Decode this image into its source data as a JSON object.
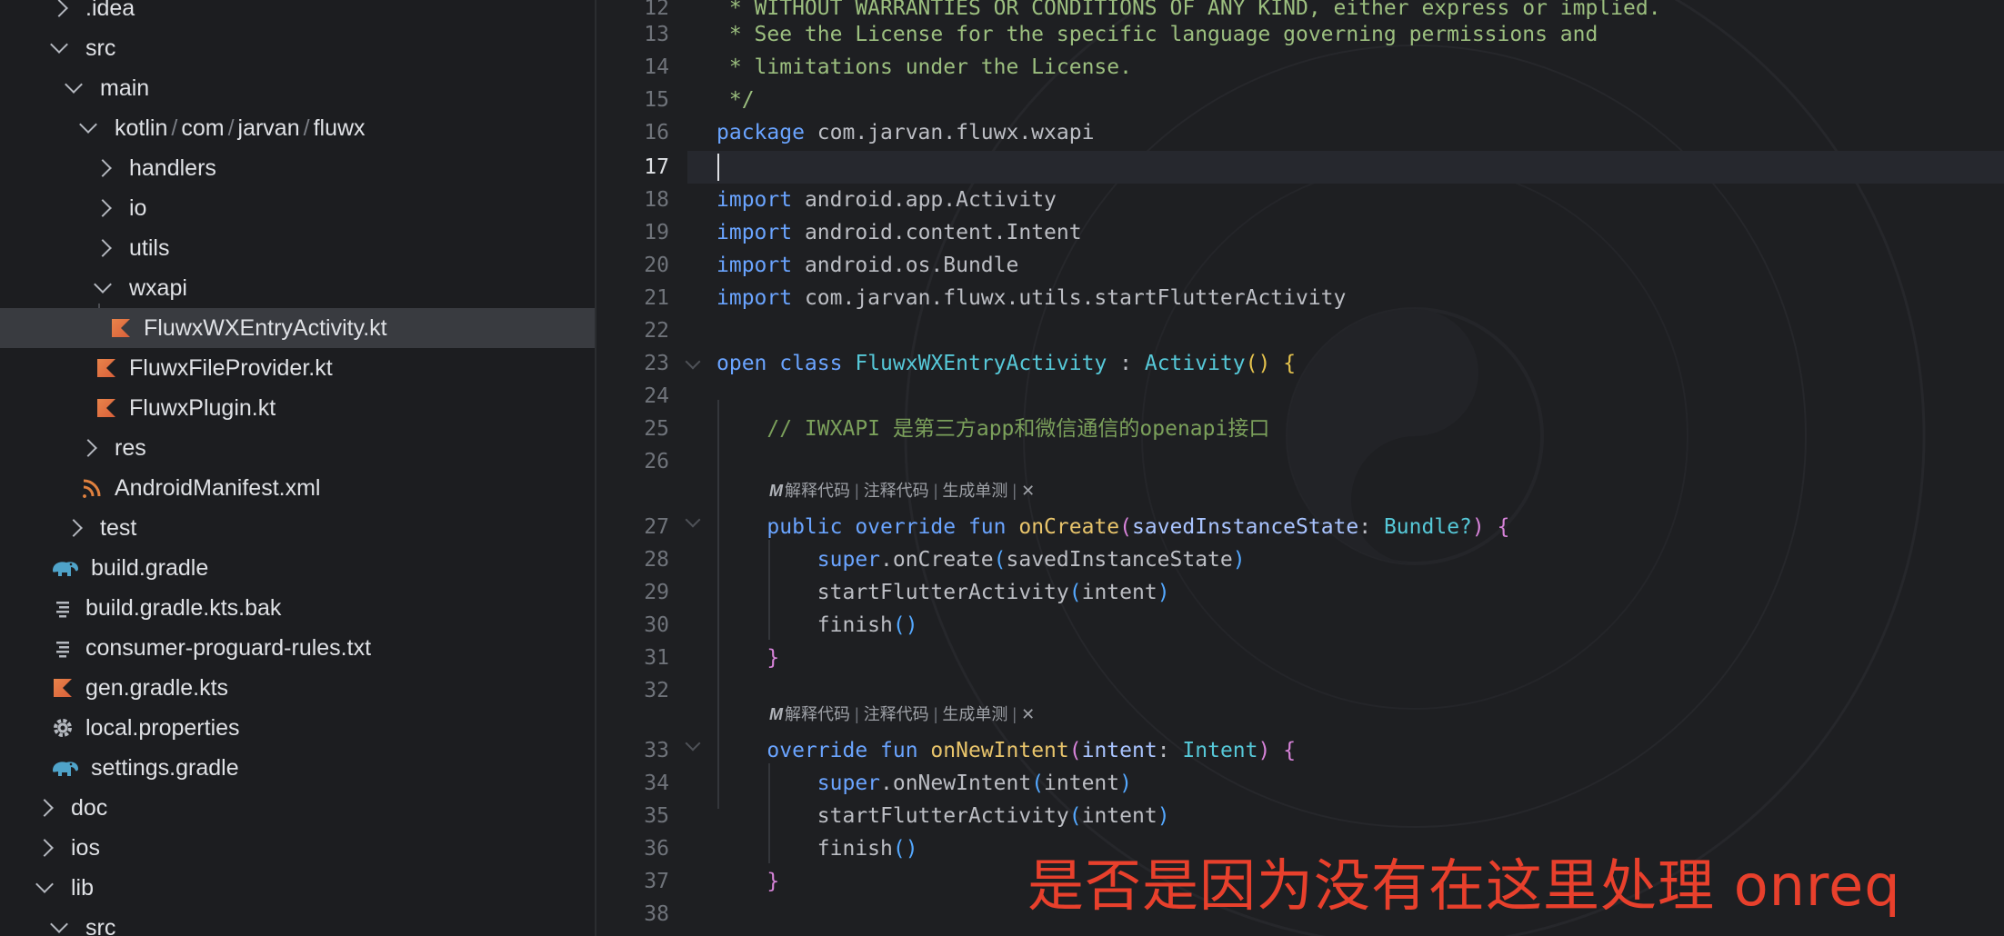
{
  "sidebar": {
    "items": [
      {
        "label": ".idea",
        "depth": 1,
        "chevron": "right",
        "icon": "none"
      },
      {
        "label": "src",
        "depth": 1,
        "chevron": "down",
        "icon": "none"
      },
      {
        "label": "main",
        "depth": 2,
        "chevron": "down",
        "icon": "none"
      },
      {
        "label_parts": [
          "kotlin",
          "com",
          "jarvan",
          "fluwx"
        ],
        "depth": 3,
        "chevron": "down",
        "icon": "none"
      },
      {
        "label": "handlers",
        "depth": 4,
        "chevron": "right",
        "icon": "none"
      },
      {
        "label": "io",
        "depth": 4,
        "chevron": "right",
        "icon": "none"
      },
      {
        "label": "utils",
        "depth": 4,
        "chevron": "right",
        "icon": "none"
      },
      {
        "label": "wxapi",
        "depth": 4,
        "chevron": "down",
        "icon": "none"
      },
      {
        "label": "FluwxWXEntryActivity.kt",
        "depth": 5,
        "chevron": "none",
        "icon": "kotlin-file-icon",
        "selected": true
      },
      {
        "label": "FluwxFileProvider.kt",
        "depth": 4,
        "chevron": "none",
        "icon": "kotlin-file-icon"
      },
      {
        "label": "FluwxPlugin.kt",
        "depth": 4,
        "chevron": "none",
        "icon": "kotlin-file-icon"
      },
      {
        "label": "res",
        "depth": 3,
        "chevron": "right",
        "icon": "none"
      },
      {
        "label": "AndroidManifest.xml",
        "depth": 3,
        "chevron": "none",
        "icon": "xml-manifest-icon"
      },
      {
        "label": "test",
        "depth": 2,
        "chevron": "right",
        "icon": "none"
      },
      {
        "label": "build.gradle",
        "depth": 1,
        "chevron": "none",
        "icon": "gradle-elephant-icon"
      },
      {
        "label": "build.gradle.kts.bak",
        "depth": 1,
        "chevron": "none",
        "icon": "text-file-icon"
      },
      {
        "label": "consumer-proguard-rules.txt",
        "depth": 1,
        "chevron": "none",
        "icon": "text-file-icon"
      },
      {
        "label": "gen.gradle.kts",
        "depth": 1,
        "chevron": "none",
        "icon": "kotlin-file-icon"
      },
      {
        "label": "local.properties",
        "depth": 1,
        "chevron": "none",
        "icon": "gear-icon"
      },
      {
        "label": "settings.gradle",
        "depth": 1,
        "chevron": "none",
        "icon": "gradle-elephant-icon"
      },
      {
        "label": "doc",
        "depth": 0,
        "chevron": "right",
        "icon": "none"
      },
      {
        "label": "ios",
        "depth": 0,
        "chevron": "right",
        "icon": "none"
      },
      {
        "label": "lib",
        "depth": 0,
        "chevron": "down",
        "icon": "none"
      },
      {
        "label": "src",
        "depth": 1,
        "chevron": "down",
        "icon": "none"
      }
    ]
  },
  "editor": {
    "current_line": "17",
    "lines": [
      {
        "num": "12",
        "segments": [
          [
            " * WITHOUT WARRANTIES OR CONDITIONS OF ANY KIND, either express or implied.",
            "lic"
          ]
        ]
      },
      {
        "num": "13",
        "segments": [
          [
            " * See the License for the specific language governing permissions and",
            "lic"
          ]
        ]
      },
      {
        "num": "14",
        "segments": [
          [
            " * limitations under the License.",
            "lic"
          ]
        ]
      },
      {
        "num": "15",
        "segments": [
          [
            " */",
            "lic"
          ]
        ]
      },
      {
        "num": "16",
        "segments": [
          [
            "package",
            "kw"
          ],
          [
            " com.jarvan.fluwx.wxapi",
            "plain"
          ]
        ]
      },
      {
        "num": "17",
        "segments": []
      },
      {
        "num": "18",
        "segments": [
          [
            "import",
            "kw"
          ],
          [
            " android.app.Activity",
            "plain"
          ]
        ]
      },
      {
        "num": "19",
        "segments": [
          [
            "import",
            "kw"
          ],
          [
            " android.content.Intent",
            "plain"
          ]
        ]
      },
      {
        "num": "20",
        "segments": [
          [
            "import",
            "kw"
          ],
          [
            " android.os.Bundle",
            "plain"
          ]
        ]
      },
      {
        "num": "21",
        "segments": [
          [
            "import",
            "kw"
          ],
          [
            " com.jarvan.fluwx.utils.startFlutterActivity",
            "plain"
          ]
        ]
      },
      {
        "num": "22",
        "segments": []
      },
      {
        "num": "23",
        "segments": [
          [
            "open class",
            "kw"
          ],
          [
            " ",
            "plain"
          ],
          [
            "FluwxWXEntryActivity",
            "cls"
          ],
          [
            " : ",
            "plain"
          ],
          [
            "Activity",
            "cls"
          ],
          [
            "()",
            "brace"
          ],
          [
            " ",
            "plain"
          ],
          [
            "{",
            "brace"
          ]
        ]
      },
      {
        "num": "24",
        "segments": []
      },
      {
        "num": "25",
        "segments": [
          [
            "    // IWXAPI 是第三方app和微信通信的openapi接口",
            "comm"
          ]
        ]
      },
      {
        "num": "26",
        "segments": []
      },
      {
        "num": "27",
        "segments": [
          [
            "    public override fun",
            "kw"
          ],
          [
            " ",
            "plain"
          ],
          [
            "onCreate",
            "fun"
          ],
          [
            "(",
            "brace2"
          ],
          [
            "savedInstanceState",
            "par"
          ],
          [
            ": ",
            "plain"
          ],
          [
            "Bundle?",
            "cls"
          ],
          [
            ")",
            "brace2"
          ],
          [
            " ",
            "plain"
          ],
          [
            "{",
            "brace2"
          ]
        ]
      },
      {
        "num": "28",
        "segments": [
          [
            "        super",
            "kw"
          ],
          [
            ".onCreate",
            "plain"
          ],
          [
            "(",
            "brace3"
          ],
          [
            "savedInstanceState",
            "plain"
          ],
          [
            ")",
            "brace3"
          ]
        ]
      },
      {
        "num": "29",
        "segments": [
          [
            "        startFlutterActivity",
            "plain"
          ],
          [
            "(",
            "brace3"
          ],
          [
            "intent",
            "plain"
          ],
          [
            ")",
            "brace3"
          ]
        ]
      },
      {
        "num": "30",
        "segments": [
          [
            "        finish",
            "plain"
          ],
          [
            "()",
            "brace3"
          ]
        ]
      },
      {
        "num": "31",
        "segments": [
          [
            "    }",
            "brace2"
          ]
        ]
      },
      {
        "num": "32",
        "segments": []
      },
      {
        "num": "33",
        "segments": [
          [
            "    override fun",
            "kw"
          ],
          [
            " ",
            "plain"
          ],
          [
            "onNewIntent",
            "fun"
          ],
          [
            "(",
            "brace2"
          ],
          [
            "intent",
            "par"
          ],
          [
            ": ",
            "plain"
          ],
          [
            "Intent",
            "cls"
          ],
          [
            ")",
            "brace2"
          ],
          [
            " ",
            "plain"
          ],
          [
            "{",
            "brace2"
          ]
        ]
      },
      {
        "num": "34",
        "segments": [
          [
            "        super",
            "kw"
          ],
          [
            ".onNewIntent",
            "plain"
          ],
          [
            "(",
            "brace3"
          ],
          [
            "intent",
            "plain"
          ],
          [
            ")",
            "brace3"
          ]
        ]
      },
      {
        "num": "35",
        "segments": [
          [
            "        startFlutterActivity",
            "plain"
          ],
          [
            "(",
            "brace3"
          ],
          [
            "intent",
            "plain"
          ],
          [
            ")",
            "brace3"
          ]
        ]
      },
      {
        "num": "36",
        "segments": [
          [
            "        finish",
            "plain"
          ],
          [
            "()",
            "brace3"
          ]
        ]
      },
      {
        "num": "37",
        "segments": [
          [
            "    }",
            "brace2"
          ]
        ]
      },
      {
        "num": "38",
        "segments": []
      }
    ],
    "codelens": {
      "ai_mark": "M",
      "explain": "解释代码",
      "comment": "注释代码",
      "unittest": "生成单测",
      "close": "✕"
    }
  },
  "overlay": {
    "annotation": "是否是因为没有在这里处理 onreq"
  }
}
